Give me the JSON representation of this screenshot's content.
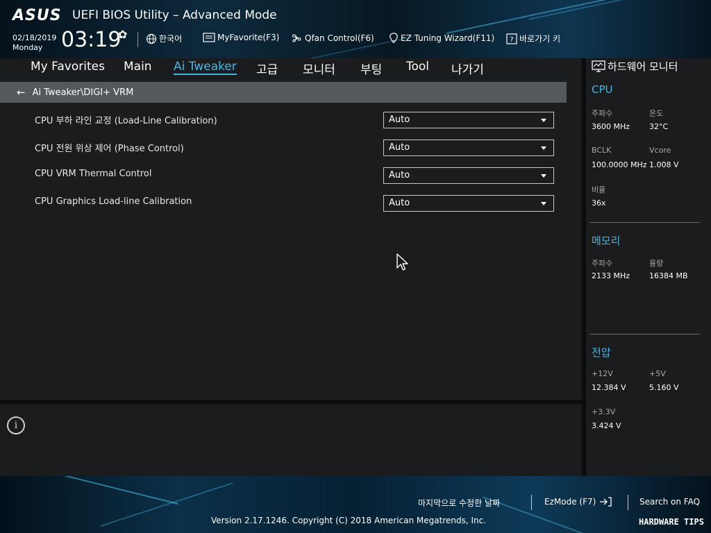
{
  "header": {
    "logo": "ASUS",
    "title": "UEFI BIOS Utility – Advanced Mode",
    "date": "02/18/2019",
    "weekday": "Monday",
    "time": "03:19",
    "language": "한국어",
    "myfavorite": "MyFavorite(F3)",
    "qfan": "Qfan Control(F6)",
    "ez_tuning": "EZ Tuning Wizard(F11)",
    "hotkey": "바로가기 키"
  },
  "nav": {
    "tabs": [
      {
        "label": "My Favorites"
      },
      {
        "label": "Main"
      },
      {
        "label": "Ai Tweaker"
      },
      {
        "label": "고급"
      },
      {
        "label": "모니터"
      },
      {
        "label": "부팅"
      },
      {
        "label": "Tool"
      },
      {
        "label": "나가기"
      }
    ],
    "active": "Ai Tweaker"
  },
  "breadcrumb": "Ai Tweaker\\DIGI+ VRM",
  "settings": [
    {
      "label": "CPU 부하 라인 교정 (Load-Line Calibration)",
      "value": "Auto"
    },
    {
      "label": "CPU 전원 위상 제어 (Phase Control)",
      "value": "Auto"
    },
    {
      "label": "CPU VRM Thermal Control",
      "value": "Auto"
    },
    {
      "label": "CPU Graphics Load-line Calibration",
      "value": "Auto"
    }
  ],
  "hardware_monitor": {
    "title": "하드웨어 모니터",
    "cpu": {
      "section": "CPU",
      "freq_label": "주파수",
      "freq_value": "3600 MHz",
      "temp_label": "온도",
      "temp_value": "32°C",
      "bclk_label": "BCLK",
      "bclk_value": "100.0000 MHz",
      "vcore_label": "Vcore",
      "vcore_value": "1.008 V",
      "ratio_label": "비율",
      "ratio_value": "36x"
    },
    "memory": {
      "section": "메모리",
      "freq_label": "주파수",
      "freq_value": "2133 MHz",
      "cap_label": "용량",
      "cap_value": "16384 MB"
    },
    "voltage": {
      "section": "전압",
      "v12_label": "+12V",
      "v12_value": "12.384 V",
      "v5_label": "+5V",
      "v5_value": "5.160 V",
      "v33_label": "+3.3V",
      "v33_value": "3.424 V"
    }
  },
  "footer": {
    "last_modified": "마지막으로 수정한 날짜",
    "ezmode": "EzMode (F7)",
    "search": "Search on FAQ",
    "version": "Version 2.17.1246. Copyright (C) 2018 American Megatrends, Inc.",
    "watermark": "HARDWARE TIPS"
  },
  "colors": {
    "accent": "#42b7e3",
    "background": "#1b1c1d",
    "breadcrumb_bg": "#56595b"
  }
}
